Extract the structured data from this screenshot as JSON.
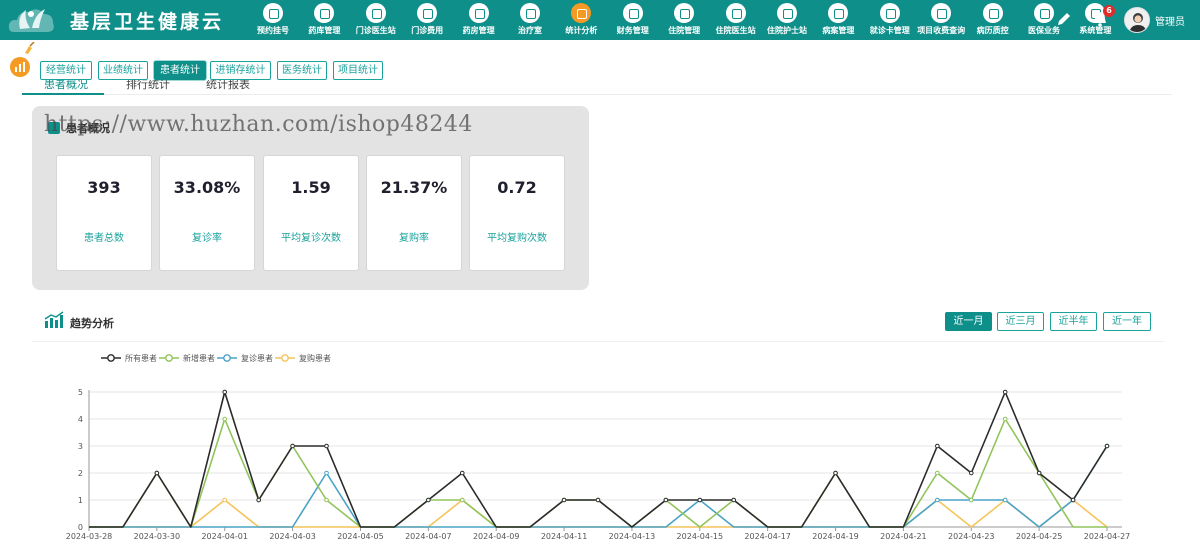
{
  "header": {
    "brand": "基层卫生健康云",
    "nav": [
      {
        "label": "预约挂号"
      },
      {
        "label": "药库管理"
      },
      {
        "label": "门诊医生站"
      },
      {
        "label": "门诊费用"
      },
      {
        "label": "药房管理"
      },
      {
        "label": "治疗室"
      },
      {
        "label": "统计分析",
        "active": true
      },
      {
        "label": "财务管理"
      },
      {
        "label": "住院管理"
      },
      {
        "label": "住院医生站"
      },
      {
        "label": "住院护士站"
      },
      {
        "label": "病案管理"
      },
      {
        "label": "就诊卡管理"
      },
      {
        "label": "项目收费查询"
      },
      {
        "label": "病历质控"
      },
      {
        "label": "医保业务"
      },
      {
        "label": "系统管理"
      }
    ],
    "notification_count": "6",
    "user_name": "管理员"
  },
  "tabs": [
    {
      "label": "经营统计"
    },
    {
      "label": "业绩统计"
    },
    {
      "label": "患者统计",
      "active": true
    },
    {
      "label": "进销存统计"
    },
    {
      "label": "医务统计"
    },
    {
      "label": "项目统计"
    }
  ],
  "subtabs": [
    {
      "label": "患者概况",
      "active": true
    },
    {
      "label": "排行统计"
    },
    {
      "label": "统计报表"
    }
  ],
  "overview": {
    "title": "患者概况",
    "watermark": "https://www.huzhan.com/ishop48244",
    "stats": [
      {
        "value": "393",
        "label": "患者总数"
      },
      {
        "value": "33.08%",
        "label": "复诊率"
      },
      {
        "value": "1.59",
        "label": "平均复诊次数"
      },
      {
        "value": "21.37%",
        "label": "复购率"
      },
      {
        "value": "0.72",
        "label": "平均复购次数"
      }
    ]
  },
  "trend": {
    "title": "趋势分析",
    "ranges": [
      {
        "label": "近一月",
        "active": true
      },
      {
        "label": "近三月"
      },
      {
        "label": "近半年"
      },
      {
        "label": "近一年"
      }
    ]
  },
  "colors": {
    "primary": "#0f8f8a",
    "accent": "#f59a23",
    "series_all": "#2b2b2b",
    "series_new": "#91c45a",
    "series_revisit": "#4aa3c7",
    "series_repurchase": "#f5c45a"
  },
  "chart_data": {
    "type": "line",
    "x": [
      "2024-03-28",
      "2024-03-29",
      "2024-03-30",
      "2024-03-31",
      "2024-04-01",
      "2024-04-02",
      "2024-04-03",
      "2024-04-04",
      "2024-04-05",
      "2024-04-06",
      "2024-04-07",
      "2024-04-08",
      "2024-04-09",
      "2024-04-10",
      "2024-04-11",
      "2024-04-12",
      "2024-04-13",
      "2024-04-14",
      "2024-04-15",
      "2024-04-16",
      "2024-04-17",
      "2024-04-18",
      "2024-04-19",
      "2024-04-20",
      "2024-04-21",
      "2024-04-22",
      "2024-04-23",
      "2024-04-24",
      "2024-04-25",
      "2024-04-26",
      "2024-04-27"
    ],
    "x_tick_labels": [
      "2024-03-28",
      "2024-03-30",
      "2024-04-01",
      "2024-04-03",
      "2024-04-05",
      "2024-04-07",
      "2024-04-09",
      "2024-04-11",
      "2024-04-13",
      "2024-04-15",
      "2024-04-17",
      "2024-04-19",
      "2024-04-21",
      "2024-04-23",
      "2024-04-25",
      "2024-04-27"
    ],
    "ylim": [
      0,
      5
    ],
    "yticks": [
      0,
      1,
      2,
      3,
      4,
      5
    ],
    "grid": true,
    "legend_position": "top-left",
    "series": [
      {
        "name": "所有患者",
        "color": "#2b2b2b",
        "values": [
          0,
          0,
          2,
          0,
          5,
          1,
          3,
          3,
          0,
          0,
          1,
          2,
          0,
          0,
          1,
          1,
          0,
          1,
          1,
          1,
          0,
          0,
          2,
          0,
          0,
          3,
          2,
          5,
          2,
          1,
          3
        ]
      },
      {
        "name": "新增患者",
        "color": "#91c45a",
        "values": [
          0,
          0,
          2,
          0,
          4,
          1,
          3,
          1,
          0,
          0,
          1,
          1,
          0,
          0,
          1,
          1,
          0,
          1,
          0,
          1,
          0,
          0,
          2,
          0,
          0,
          2,
          1,
          4,
          2,
          0,
          0
        ]
      },
      {
        "name": "复诊患者",
        "color": "#4aa3c7",
        "values": [
          0,
          0,
          0,
          0,
          0,
          0,
          0,
          2,
          0,
          0,
          0,
          0,
          0,
          0,
          0,
          0,
          0,
          0,
          1,
          0,
          0,
          0,
          0,
          0,
          0,
          1,
          1,
          1,
          0,
          1,
          3
        ]
      },
      {
        "name": "复购患者",
        "color": "#f5c45a",
        "values": [
          0,
          0,
          0,
          0,
          1,
          0,
          0,
          0,
          0,
          0,
          0,
          1,
          0,
          0,
          0,
          0,
          0,
          0,
          0,
          0,
          0,
          0,
          0,
          0,
          0,
          1,
          0,
          1,
          0,
          1,
          0
        ]
      }
    ]
  }
}
